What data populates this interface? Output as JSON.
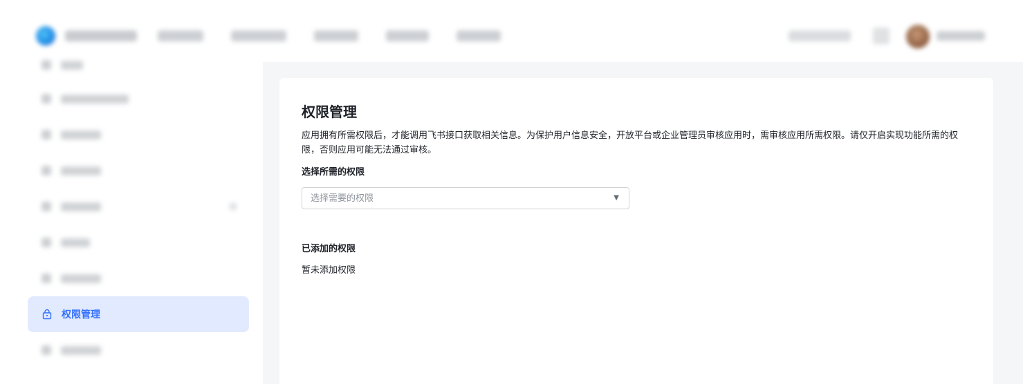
{
  "header": {
    "nav_items_blurred": 5,
    "blurred": true
  },
  "sidebar": {
    "active_item": {
      "label": "权限管理",
      "icon": "lock-icon",
      "color": "#3370ff",
      "background": "#e1eaff"
    },
    "blurred": true
  },
  "main": {
    "title": "权限管理",
    "description": "应用拥有所需权限后，才能调用飞书接口获取相关信息。为保护用户信息安全，开放平台或企业管理员审核应用时，需审核应用所需权限。请仅开启实现功能所需的权限，否则应用可能无法通过审核。",
    "select_section_label": "选择所需的权限",
    "select": {
      "placeholder": "选择需要的权限",
      "caret_icon": "caret-down-icon"
    },
    "added_section_label": "已添加的权限",
    "empty_text": "暂未添加权限"
  }
}
